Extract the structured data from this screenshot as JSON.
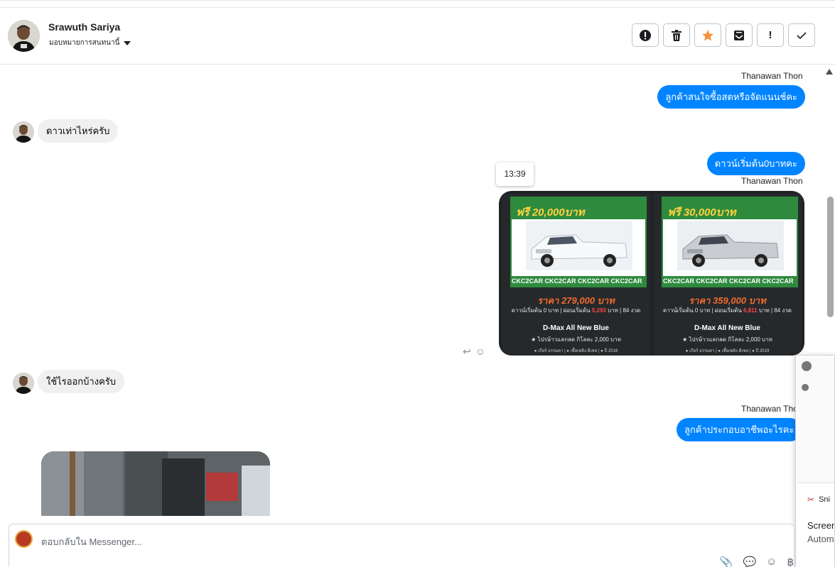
{
  "header": {
    "contact_name": "Srawuth Sariya",
    "assign_label": "มอบหมายการสนทนานี้",
    "actions": [
      {
        "name": "spam-button",
        "icon": "alert-circle-icon",
        "glyph": "!"
      },
      {
        "name": "delete-button",
        "icon": "trash-icon",
        "glyph": "🗑"
      },
      {
        "name": "star-button",
        "icon": "star-icon",
        "glyph": "★"
      },
      {
        "name": "move-to-inbox-button",
        "icon": "archive-icon",
        "glyph": "⌂"
      },
      {
        "name": "mark-priority-button",
        "icon": "exclamation-icon",
        "glyph": "!"
      },
      {
        "name": "mark-done-button",
        "icon": "check-icon",
        "glyph": "✓"
      }
    ]
  },
  "chat": {
    "sender_1": "Thanawan Thon",
    "msg_out_1": "ลูกค้าสนใจซื้อสดหรือจัดแนนช์คะ",
    "msg_in_1": "ดาวเท่าไหร่ครับ",
    "msg_out_2": "ดาวน์เริ่มต้น0บาทคะ",
    "tooltip_time": "13:39",
    "sender_2": "Thanawan Thon",
    "msg_in_2": "ใช้ไรออกบ้างครับ",
    "sender_3": "Thanawan Thon",
    "msg_out_3": "ลูกค้าประกอบอาชีพอะไรคะ"
  },
  "cards": [
    {
      "promo": "ฟรี 20,000บาท",
      "strip": "CKC2CAR CKC2CAR CKC2CAR CKC2CAR",
      "price": "ราคา 279,000 บาท",
      "terms_a": "ดาวน์เริ่มต้น 0 บาท | ผ่อนเริ่มต้น",
      "terms_red": "5,293",
      "terms_b": "บาท | 84 งวด",
      "model": "D-Max All New Blue",
      "promo2": "★ ไปรษ้าวแลกลด กิโลละ 2,000 บาท",
      "meta": "● เกียร์ ธรรมดา | ● เชื้อเพลิง ดีเซล | ● ปี 2016"
    },
    {
      "promo": "ฟรี 30,000บาท",
      "strip": "CKC2CAR CKC2CAR CKC2CAR CKC2CAR",
      "price": "ราคา 359,000 บาท",
      "terms_a": "ดาวน์เริ่มต้น 0 บาท | ผ่อนเริ่มต้น",
      "terms_red": "6,811",
      "terms_b": "บาท | 84 งวด",
      "model": "D-Max All New Blue",
      "promo2": "★ ไปรษ้าวแลกลด กิโลละ 2,000 บาท",
      "meta": "● เกียร์ ธรรมดา | ● เชื้อเพลิง ดีเซล | ● ปี 2019"
    }
  ],
  "snip": {
    "title": "Sni",
    "heading": "Screen",
    "sub": "Autom"
  },
  "composer": {
    "placeholder": "ตอบกลับใน Messenger..."
  }
}
